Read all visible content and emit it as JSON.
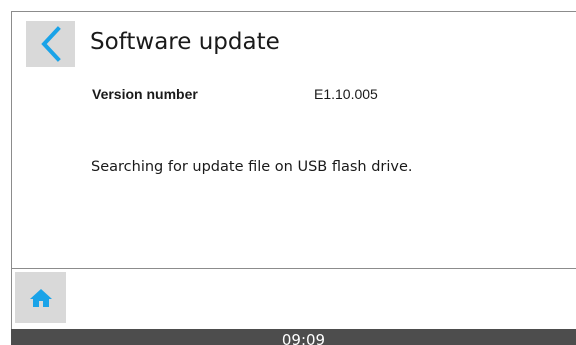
{
  "header": {
    "title": "Software update",
    "back_icon": "chevron-left-icon"
  },
  "details": {
    "version_label": "Version number",
    "version_value": "E1.10.005"
  },
  "status": {
    "message": "Searching for update file on USB flash drive."
  },
  "footer": {
    "home_icon": "home-icon"
  },
  "status_bar": {
    "time": "09:09"
  },
  "colors": {
    "accent": "#1aa3e8",
    "button_bg": "#d9d9d9",
    "status_bar_bg": "#4d4d4d"
  }
}
